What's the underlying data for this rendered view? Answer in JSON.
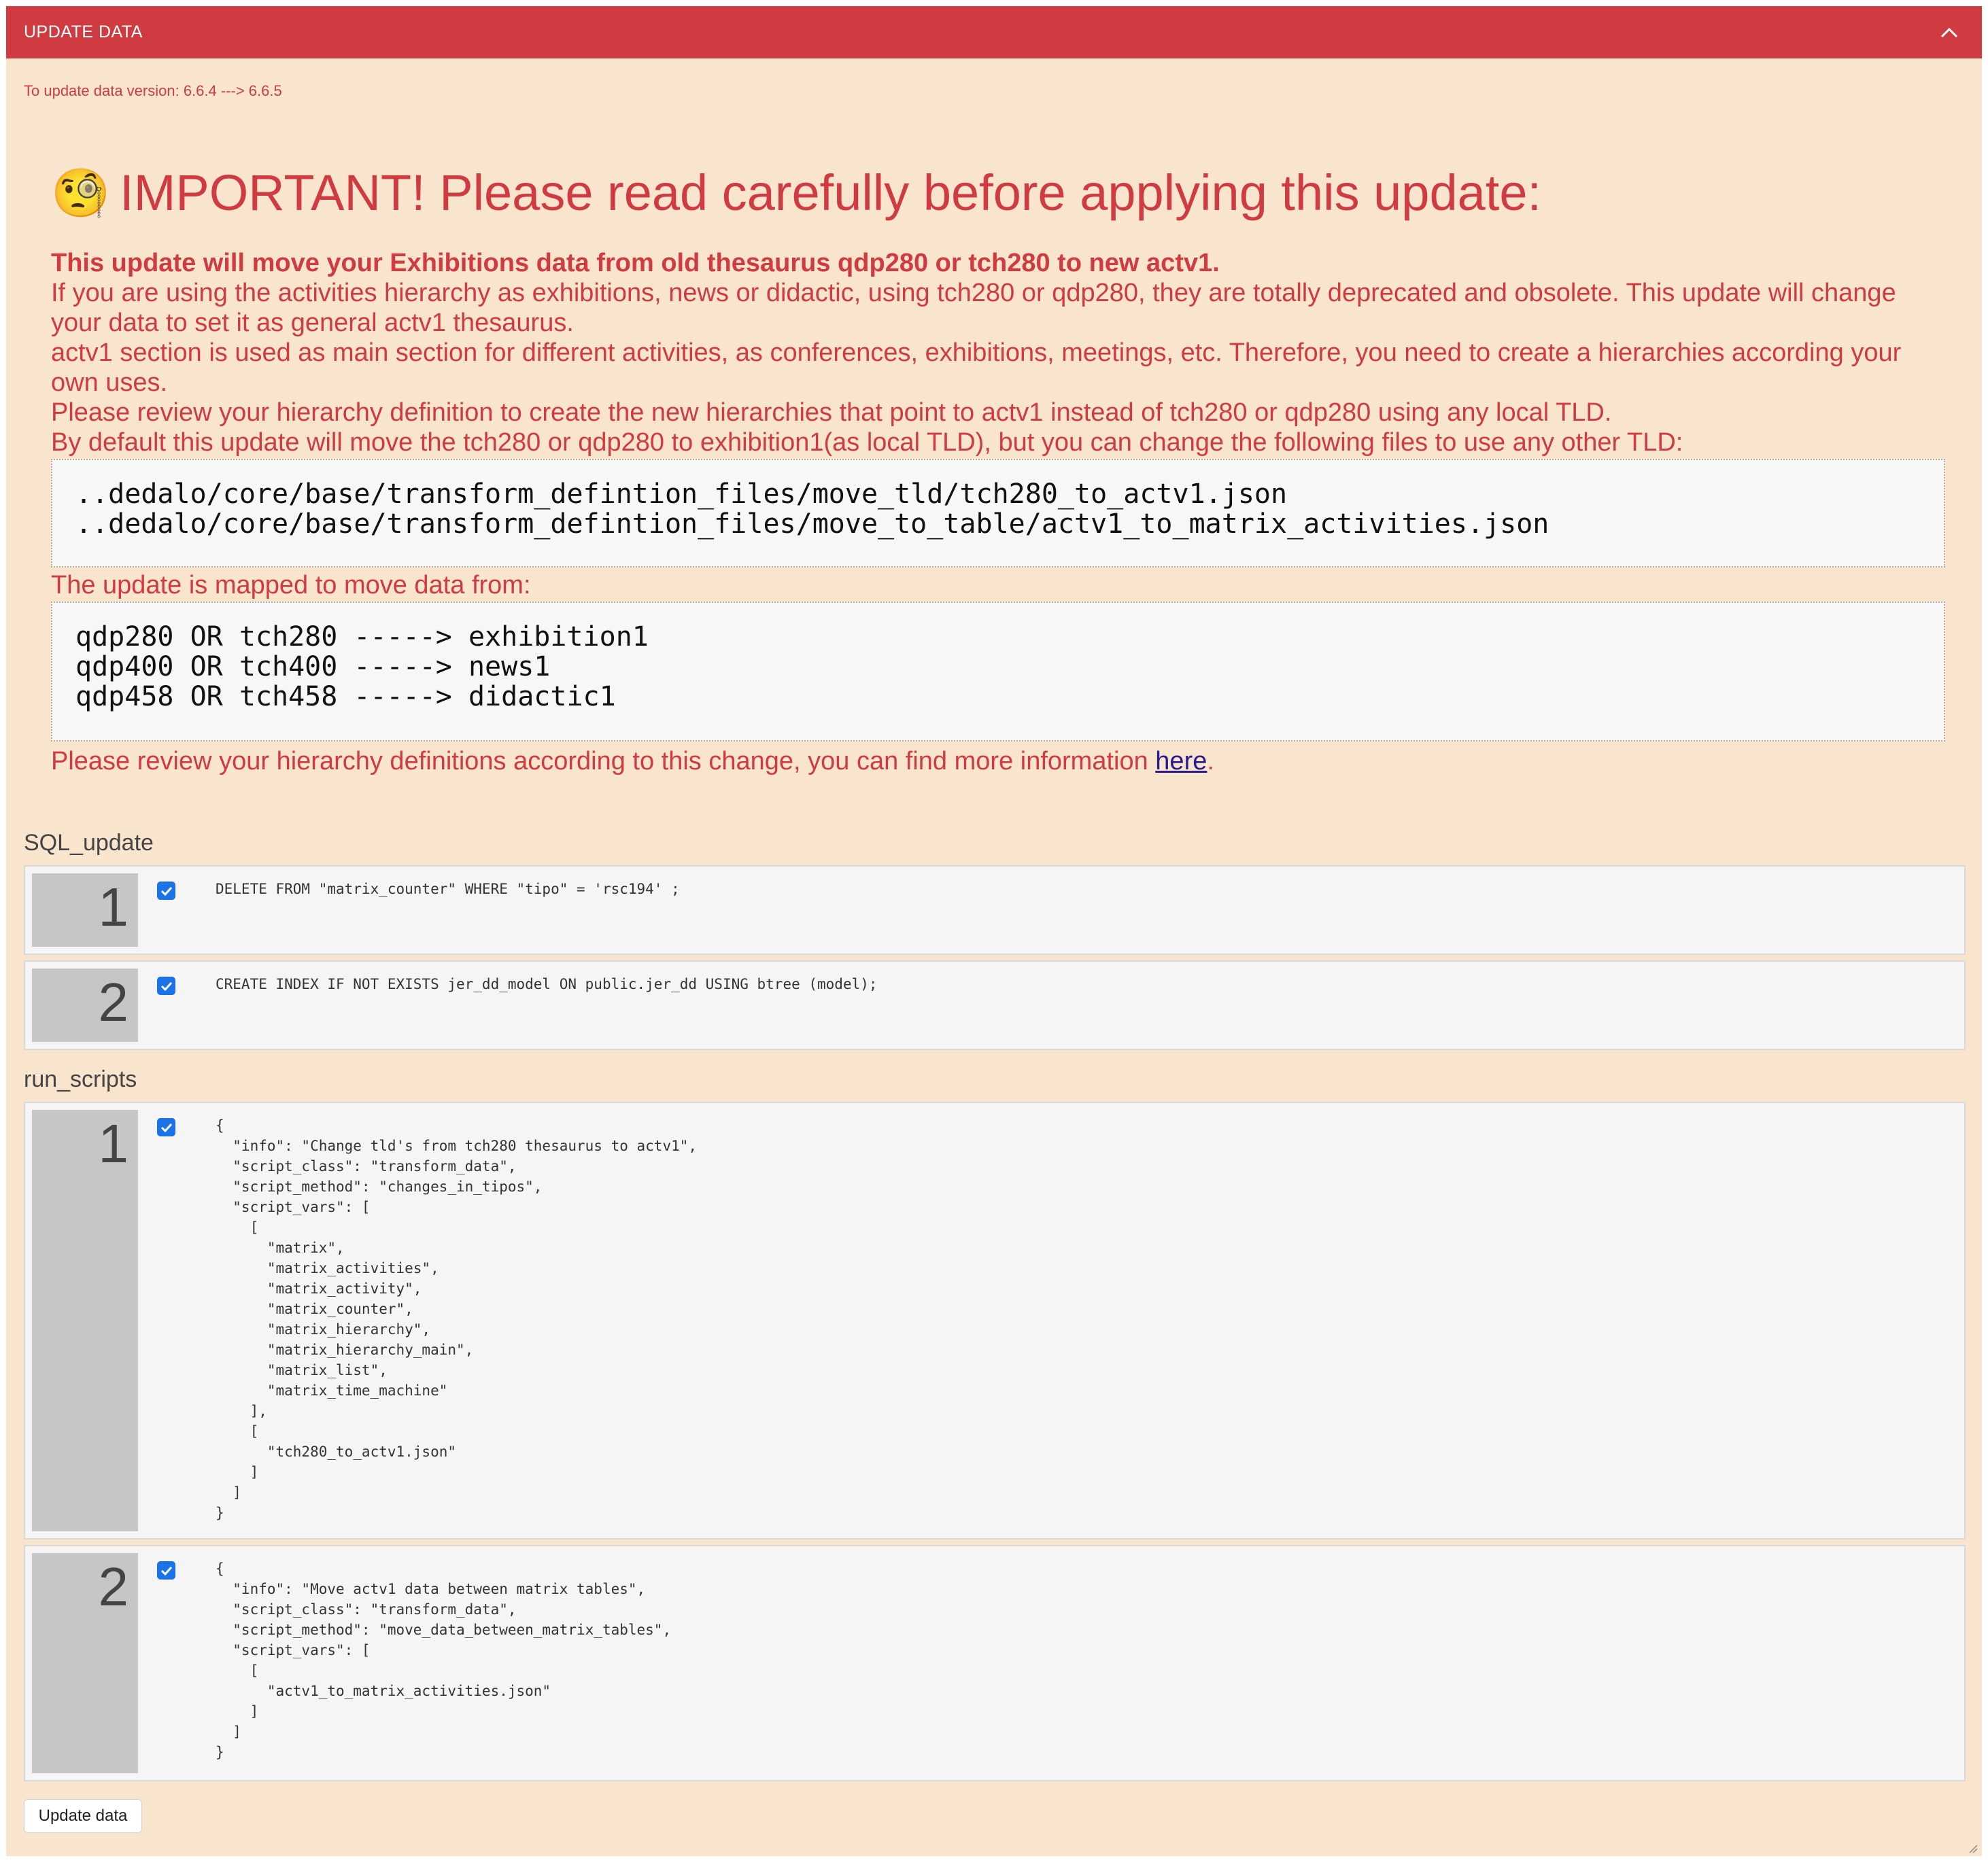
{
  "header": {
    "title": "UPDATE DATA",
    "collapse_icon": "chevron-up-icon"
  },
  "version_line": "To update data version: 6.6.4 ---> 6.6.5",
  "notice": {
    "emoji": "🧐",
    "title": "IMPORTANT! Please read carefully before applying this update:",
    "bold_line": "This update will move your Exhibitions data from old thesaurus qdp280 or tch280 to new actv1.",
    "paragraph_1": "If you are using the activities hierarchy as exhibitions, news or didactic, using tch280 or qdp280, they are totally deprecated and obsolete. This update will change your data to set it as general actv1 thesaurus.",
    "paragraph_2": "actv1 section is used as main section for different activities, as conferences, exhibitions, meetings, etc. Therefore, you need to create a hierarchies according your own uses.",
    "paragraph_3": "Please review your hierarchy definition to create the new hierarchies that point to actv1 instead of tch280 or qdp280 using any local TLD.",
    "paragraph_4": "By default this update will move the tch280 or qdp280 to exhibition1(as local TLD), but you can change the following files to use any other TLD:",
    "files_code": "..dedalo/core/base/transform_defintion_files/move_tld/tch280_to_actv1.json\n..dedalo/core/base/transform_defintion_files/move_to_table/actv1_to_matrix_activities.json",
    "mapped_label": "The update is mapped to move data from:",
    "mapping_code": "qdp280 OR tch280 -----> exhibition1\nqdp400 OR tch400 -----> news1\nqdp458 OR tch458 -----> didactic1",
    "review_text": "Please review your hierarchy definitions according to this change, you can find more information ",
    "review_link": "here",
    "review_end": "."
  },
  "sql_update": {
    "label": "SQL_update",
    "items": [
      {
        "number": "1",
        "checked": true,
        "code": "DELETE FROM \"matrix_counter\" WHERE \"tipo\" = 'rsc194' ;"
      },
      {
        "number": "2",
        "checked": true,
        "code": "CREATE INDEX IF NOT EXISTS jer_dd_model ON public.jer_dd USING btree (model);"
      }
    ]
  },
  "run_scripts": {
    "label": "run_scripts",
    "items": [
      {
        "number": "1",
        "checked": true,
        "code": "{\n  \"info\": \"Change tld's from tch280 thesaurus to actv1\",\n  \"script_class\": \"transform_data\",\n  \"script_method\": \"changes_in_tipos\",\n  \"script_vars\": [\n    [\n      \"matrix\",\n      \"matrix_activities\",\n      \"matrix_activity\",\n      \"matrix_counter\",\n      \"matrix_hierarchy\",\n      \"matrix_hierarchy_main\",\n      \"matrix_list\",\n      \"matrix_time_machine\"\n    ],\n    [\n      \"tch280_to_actv1.json\"\n    ]\n  ]\n}"
      },
      {
        "number": "2",
        "checked": true,
        "code": "{\n  \"info\": \"Move actv1 data between matrix tables\",\n  \"script_class\": \"transform_data\",\n  \"script_method\": \"move_data_between_matrix_tables\",\n  \"script_vars\": [\n    [\n      \"actv1_to_matrix_activities.json\"\n    ]\n  ]\n}"
      }
    ]
  },
  "update_button": "Update data",
  "colors": {
    "header_bg": "#cf3b40",
    "panel_bg": "#f9e4cd",
    "notice_text": "#cf3b40",
    "checkbox": "#1a73e8"
  }
}
